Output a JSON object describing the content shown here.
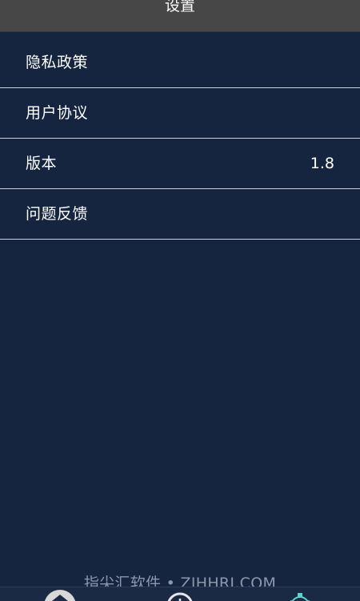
{
  "header": {
    "title": "设置"
  },
  "settings": {
    "items": [
      {
        "label": "隐私政策",
        "value": ""
      },
      {
        "label": "用户协议",
        "value": ""
      },
      {
        "label": "版本",
        "value": "1.8"
      },
      {
        "label": "问题反馈",
        "value": ""
      }
    ]
  },
  "watermark": {
    "text": "指尖汇软件 • ZJHHRJ.COM"
  },
  "tabbar": {
    "tabs": [
      {
        "icon": "home-icon"
      },
      {
        "icon": "clock-icon"
      },
      {
        "icon": "gear-icon"
      }
    ]
  },
  "colors": {
    "background": "#15253f",
    "header": "#474747",
    "divider": "#c9d0da",
    "text": "#ffffff",
    "watermark": "#8d97ab",
    "active_tab": "#5fd3c8"
  }
}
